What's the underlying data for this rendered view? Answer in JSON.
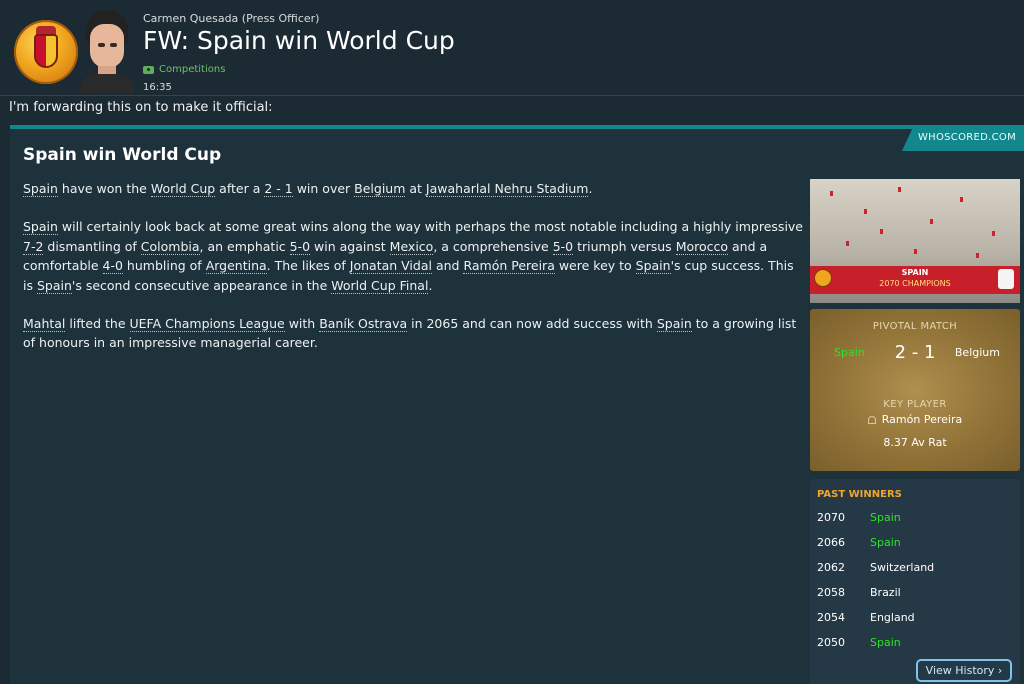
{
  "header": {
    "sender": "Carmen Quesada  (Press Officer)",
    "title": "FW: Spain win World Cup",
    "tag": "Competitions",
    "time": "16:35",
    "tag_icon": "tag-icon",
    "crest_icon": "spain-crest-icon"
  },
  "intro": "I'm forwarding this on to make it official:",
  "article": {
    "source": "WHOSCORED.COM",
    "title": "Spain win World Cup",
    "p1": {
      "team": "Spain",
      "t1": " have won the ",
      "competition": "World Cup",
      "t2": " after a ",
      "score": "2 - 1",
      "t3": " win over ",
      "opponent": "Belgium",
      "t4": " at ",
      "stadium": "Jawaharlal Nehru Stadium",
      "t5": "."
    },
    "p2": {
      "team": "Spain",
      "t1": " will certainly look back at some great wins along the way with perhaps the most notable including a highly impressive ",
      "s1": "7-2",
      "t2": " dismantling of ",
      "o1": "Colombia",
      "t3": ", an emphatic ",
      "s2": "5-0",
      "t4": " win against ",
      "o2": "Mexico",
      "t5": ", a comprehensive ",
      "s3": "5-0",
      "t6": " triumph versus ",
      "o3": "Morocco",
      "t7": " and a comfortable ",
      "s4": "4-0",
      "t8": " humbling of ",
      "o4": "Argentina",
      "t9": ". The likes of ",
      "p1": "Jonatan Vidal",
      "t10": " and ",
      "p2": "Ramón Pereira",
      "t11": " were key to ",
      "team2": "Spain",
      "t12": "'s cup success. This is ",
      "team3": "Spain",
      "t13": "'s second consecutive appearance in the ",
      "competition": "World Cup Final",
      "t14": "."
    },
    "p3": {
      "manager": "Mahtal",
      "t1": " lifted the ",
      "competition": "UEFA Champions League",
      "t2": " with ",
      "club": "Baník Ostrava",
      "t3": " in 2065 and can now add success with ",
      "team": "Spain",
      "t4": " to a growing list of honours in an impressive managerial career."
    }
  },
  "photo": {
    "banner_team": "SPAIN",
    "banner_text": "2070 CHAMPIONS"
  },
  "pivotal": {
    "label": "PIVOTAL MATCH",
    "home": "Spain",
    "score": "2 - 1",
    "away": "Belgium",
    "key_label": "KEY PLAYER",
    "player": "Ramón Pereira",
    "rating": "8.37 Av Rat",
    "home_color": "#2ee02e"
  },
  "winners": {
    "title": "PAST WINNERS",
    "rows": [
      {
        "year": "2070",
        "team": "Spain",
        "color": "#2ee02e"
      },
      {
        "year": "2066",
        "team": "Spain",
        "color": "#2ee02e"
      },
      {
        "year": "2062",
        "team": "Switzerland",
        "color": "#ffffff"
      },
      {
        "year": "2058",
        "team": "Brazil",
        "color": "#ffffff"
      },
      {
        "year": "2054",
        "team": "England",
        "color": "#ffffff"
      },
      {
        "year": "2050",
        "team": "Spain",
        "color": "#2ee02e"
      }
    ],
    "button": "View History ›"
  }
}
